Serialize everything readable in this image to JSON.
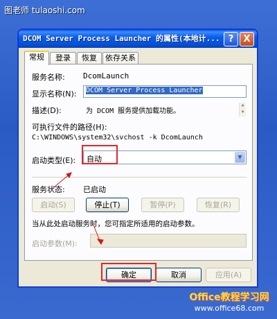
{
  "watermark_top": "图老师 tulaoshi.com",
  "watermark_bottom": {
    "line1": "Office教程学习网",
    "line2": "www.office68.com"
  },
  "window": {
    "title": "DCOM Server Process Launcher 的属性(本地计...",
    "help_glyph": "?",
    "close_glyph": "X"
  },
  "tabs": [
    {
      "label": "常规",
      "active": true
    },
    {
      "label": "登录",
      "active": false
    },
    {
      "label": "恢复",
      "active": false
    },
    {
      "label": "依存关系",
      "active": false
    }
  ],
  "general": {
    "service_name_label": "服务名称:",
    "service_name_value": "DcomLaunch",
    "display_name_label": "显示名称(N):",
    "display_name_value": "DCOM Server Process Launcher",
    "description_label": "描述(D):",
    "description_value": "为 DCOM 服务提供加载功能。",
    "exe_path_label": "可执行文件的路径(H):",
    "exe_path_value": "C:\\WINDOWS\\system32\\svchost -k DcomLaunch",
    "startup_type_label": "启动类型(E):",
    "startup_type_value": "自动",
    "service_status_label": "服务状态:",
    "service_status_value": "已启动",
    "buttons": {
      "start": "启动(S)",
      "stop": "停止(T)",
      "pause": "暂停(P)",
      "resume": "恢复(R)"
    },
    "hint": "当从此处启动服务时，您可指定所适用的启动参数。",
    "start_params_label": "启动参数(M):",
    "start_params_value": ""
  },
  "footer": {
    "ok": "确定",
    "cancel": "取消",
    "apply": "应用(A)"
  },
  "colors": {
    "highlight_box": "#e0262c",
    "title_bar": "#0552d8",
    "selection": "#316ac5"
  }
}
